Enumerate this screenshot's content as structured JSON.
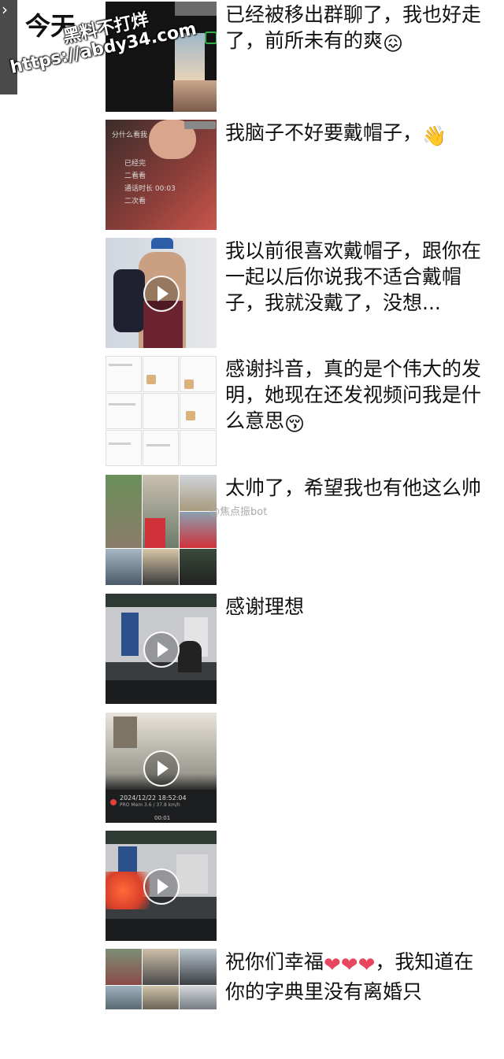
{
  "header": {
    "date_label": "今天",
    "back_glyph": "›"
  },
  "watermark": {
    "line1": "黑料不打烊",
    "line2": "https://abdy34.com"
  },
  "posts": [
    {
      "caption": "已经被移出群聊了，我也好走了，前所未有的爽",
      "emoji": "😖"
    },
    {
      "caption": "我脑子不好要戴帽子，",
      "emoji": "👋"
    },
    {
      "caption": "我以前很喜欢戴帽子，跟你在一起以后你说我不适合戴帽子，我就没戴了，没想...",
      "emoji": ""
    },
    {
      "caption": "感谢抖音，真的是个伟大的发明，她现在还发视频问我是什么意思",
      "emoji": "😚"
    },
    {
      "caption": "太帅了，希望我也有他这么帅",
      "emoji": "",
      "thumb_credit": "@焦点振bot"
    },
    {
      "caption": "感谢理想",
      "emoji": ""
    },
    {
      "caption": "",
      "emoji": ""
    },
    {
      "caption": "",
      "emoji": ""
    },
    {
      "caption_a": "祝你们幸福",
      "hearts": "❤❤❤",
      "caption_b": "，我知道在你的字典里没有离婚只"
    }
  ],
  "thumb_texts": {
    "p2_rows": [
      "分什么看我",
      "已经完",
      "二看看",
      "通话时长 00:03",
      "二次看"
    ],
    "p7_timestamp": "2024/12/22  18:52:04",
    "p7_sub": "PRO Mem  3.6 / 37.8 km/h",
    "p7_time": "00:01"
  },
  "colors": {
    "text": "#111111",
    "heart": "#e8465f",
    "watermark": "#ffffff"
  }
}
